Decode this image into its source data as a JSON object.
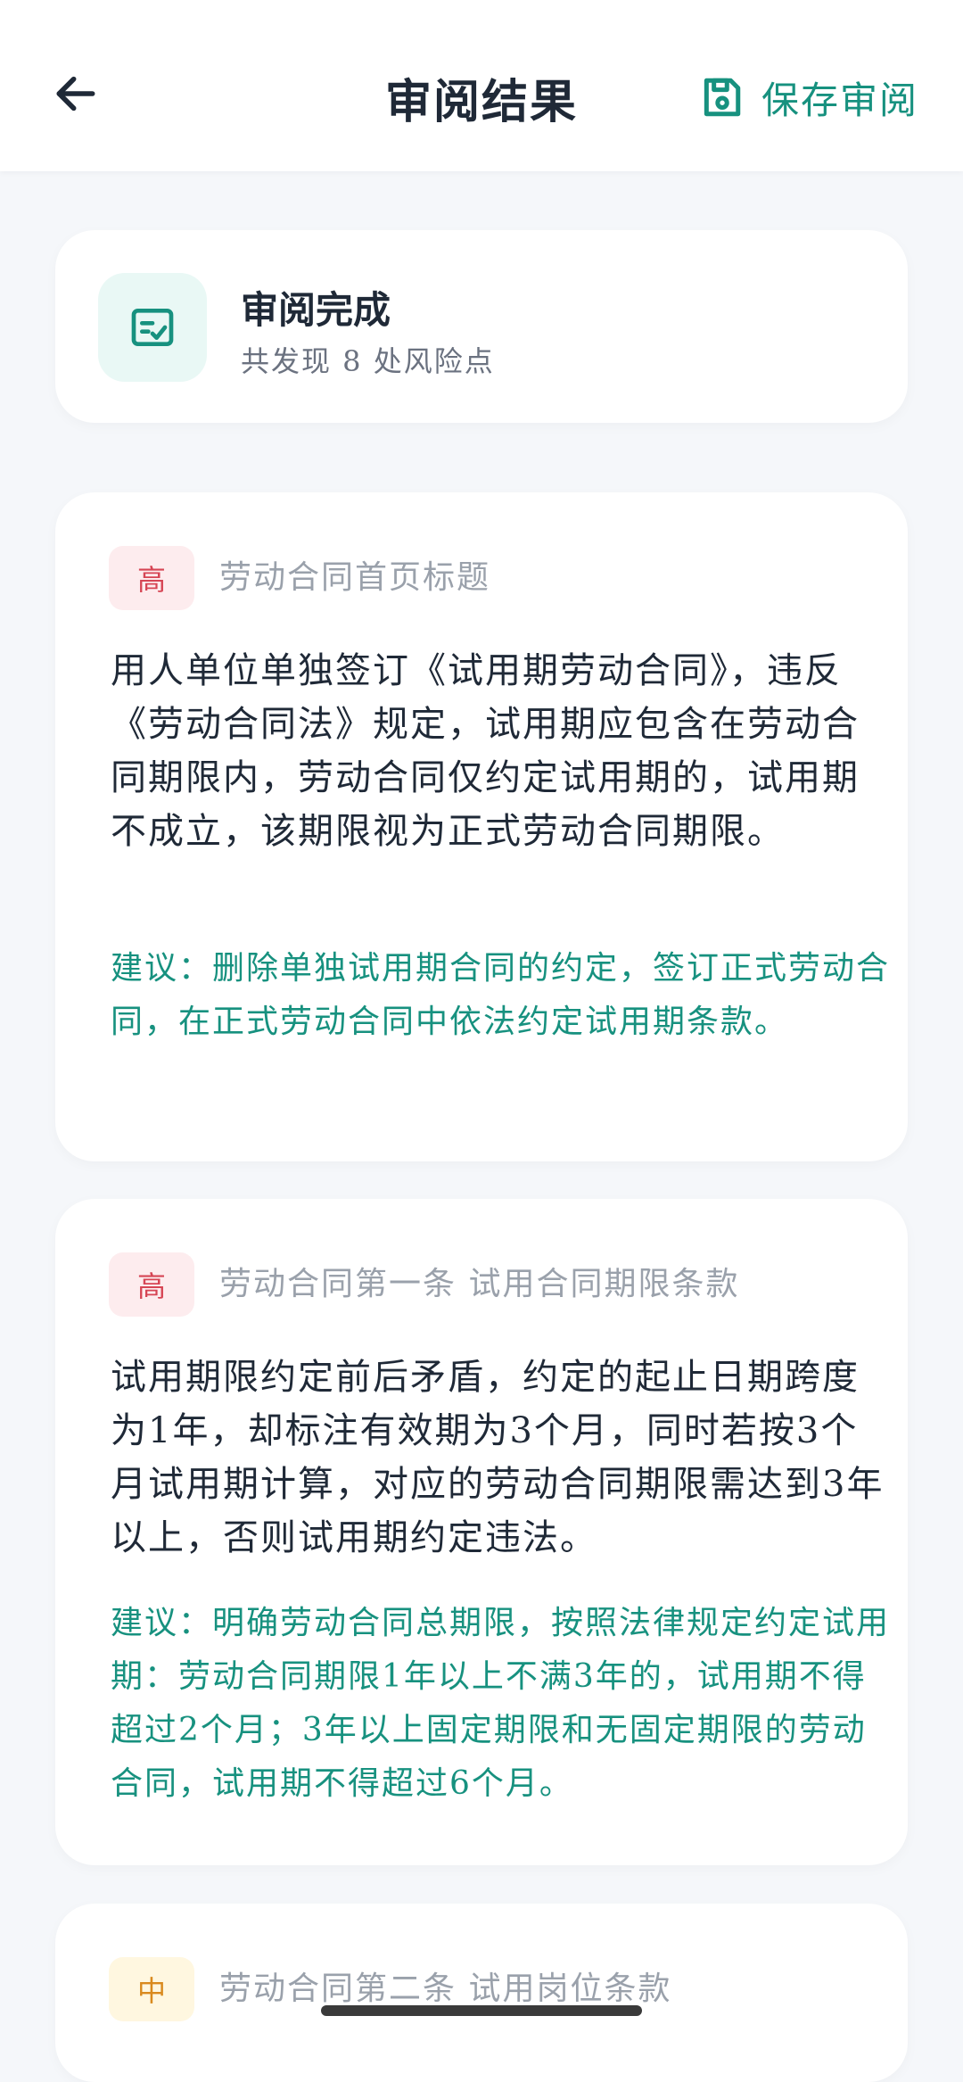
{
  "header": {
    "title": "审阅结果",
    "save_label": "保存审阅"
  },
  "summary": {
    "title": "审阅完成",
    "subtitle": "共发现 8 处风险点"
  },
  "risks": [
    {
      "level": "高",
      "section": "劳动合同首页标题",
      "description": "用人单位单独签订《试用期劳动合同》，违反《劳动合同法》规定，试用期应包含在劳动合同期限内，劳动合同仅约定试用期的，试用期不成立，该期限视为正式劳动合同期限。",
      "suggestion": "建议：删除单独试用期合同的约定，签订正式劳动合同，在正式劳动合同中依法约定试用期条款。"
    },
    {
      "level": "高",
      "section": "劳动合同第一条 试用合同期限条款",
      "description": "试用期限约定前后矛盾，约定的起止日期跨度为1年，却标注有效期为3个月，同时若按3个月试用期计算，对应的劳动合同期限需达到3年以上，否则试用期约定违法。",
      "suggestion": "建议：明确劳动合同总期限，按照法律规定约定试用期：劳动合同期限1年以上不满3年的，试用期不得超过2个月；3年以上固定期限和无固定期限的劳动合同，试用期不得超过6个月。"
    },
    {
      "level": "中",
      "section": "劳动合同第二条 试用岗位条款"
    }
  ],
  "colors": {
    "accent": "#17917f",
    "high": "#d64554",
    "medium": "#d98a1e",
    "background": "#f5f7fa"
  }
}
